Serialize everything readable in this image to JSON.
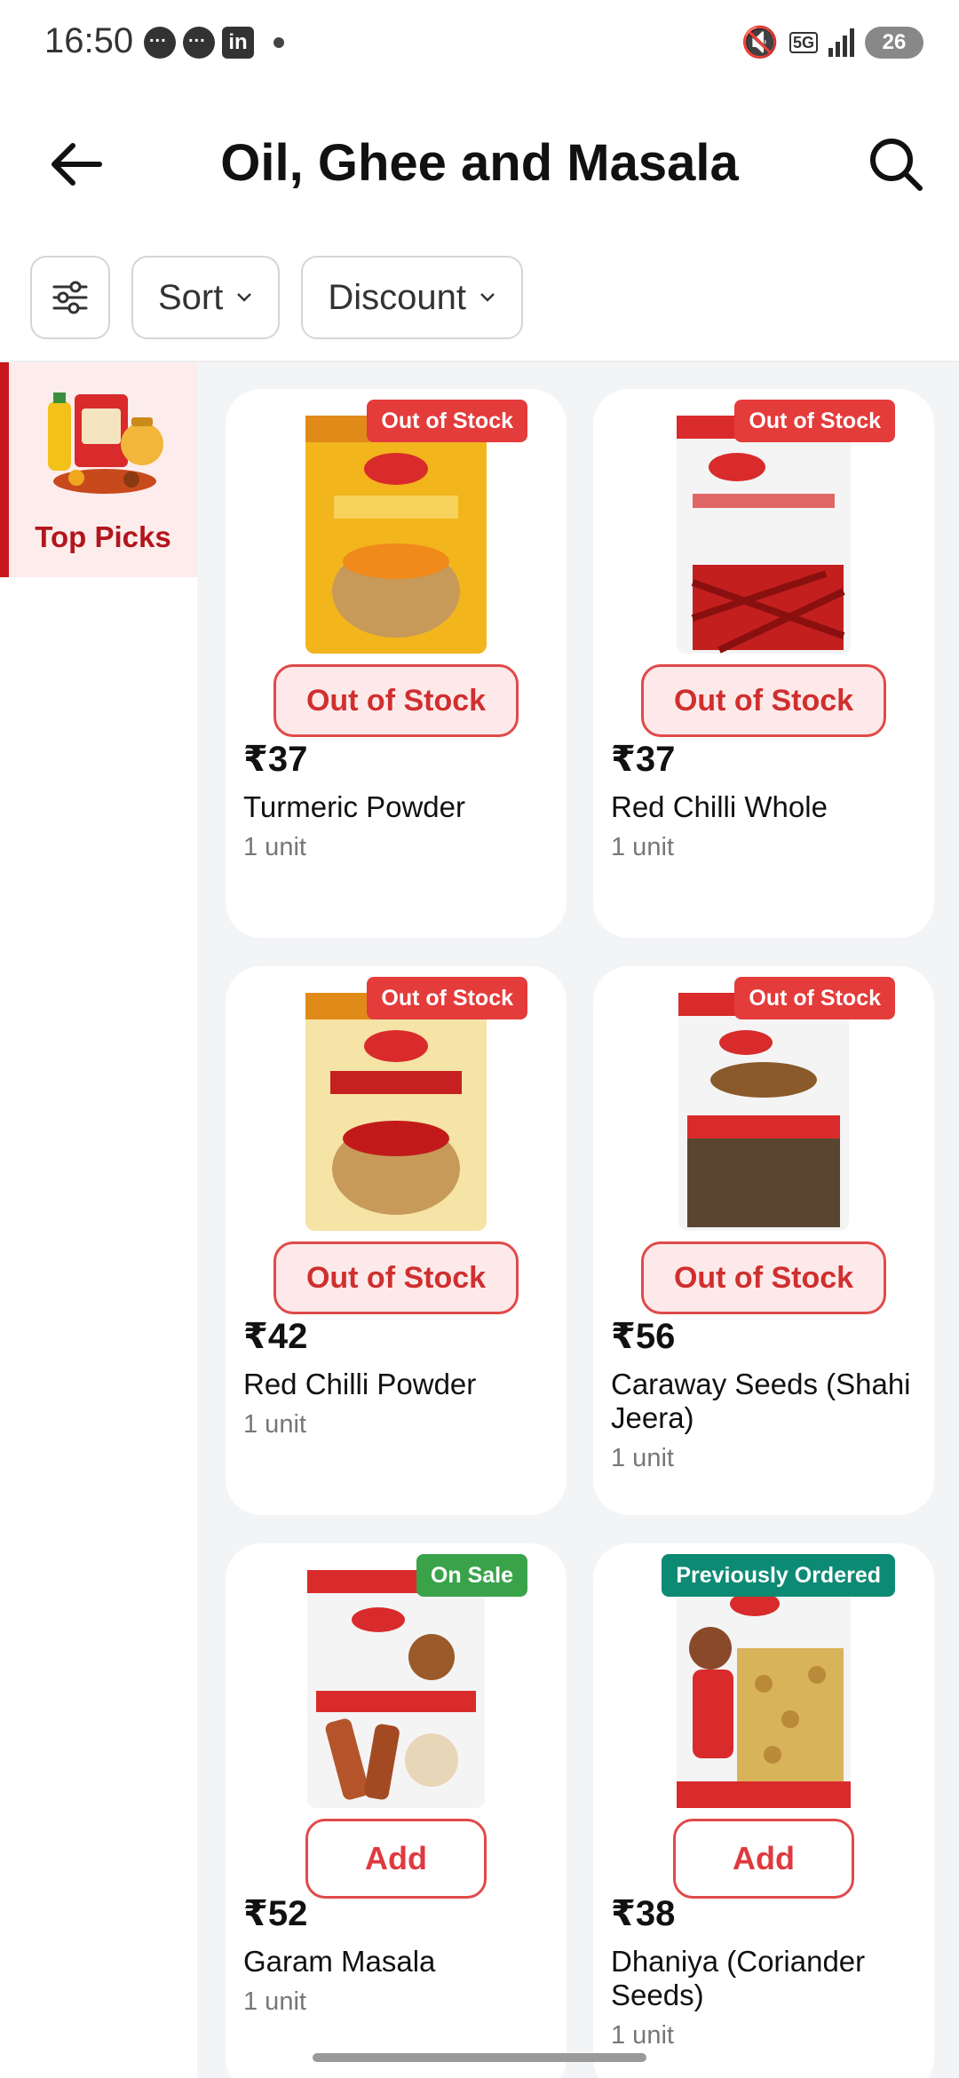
{
  "status_bar": {
    "time": "16:50",
    "network": "5G",
    "battery": "26"
  },
  "header": {
    "title": "Oil, Ghee and Masala"
  },
  "filters": {
    "sort_label": "Sort",
    "discount_label": "Discount"
  },
  "sidebar": {
    "items": [
      {
        "label": "Top Picks",
        "active": true
      }
    ]
  },
  "products": [
    {
      "badge": "Out of Stock",
      "badge_type": "oos",
      "action": "Out of Stock",
      "price": "₹37",
      "name": "Turmeric Powder",
      "unit": "1 unit",
      "image_colors": [
        "#f2b51c",
        "#e94e25"
      ]
    },
    {
      "badge": "Out of Stock",
      "badge_type": "oos",
      "action": "Out of Stock",
      "price": "₹37",
      "name": "Red Chilli Whole",
      "unit": "1 unit",
      "image_colors": [
        "#d92b2b",
        "#f5f5f5"
      ]
    },
    {
      "badge": "Out of Stock",
      "badge_type": "oos",
      "action": "Out of Stock",
      "price": "₹42",
      "name": "Red Chilli Powder",
      "unit": "1 unit",
      "image_colors": [
        "#f4dc8a",
        "#c62020"
      ]
    },
    {
      "badge": "Out of Stock",
      "badge_type": "oos",
      "action": "Out of Stock",
      "price": "₹56",
      "name": "Caraway Seeds (Shahi Jeera)",
      "unit": "1 unit",
      "image_colors": [
        "#4a3a2a",
        "#d92b2b"
      ]
    },
    {
      "badge": "On Sale",
      "badge_type": "sale",
      "action": "Add",
      "price": "₹52",
      "name": "Garam Masala",
      "unit": "1 unit",
      "image_colors": [
        "#b5542a",
        "#d92b2b"
      ]
    },
    {
      "badge": "Previously Ordered",
      "badge_type": "prev",
      "action": "Add",
      "price": "₹38",
      "name": "Dhaniya (Coriander Seeds)",
      "unit": "1 unit",
      "image_colors": [
        "#d9b35a",
        "#d92b2b"
      ]
    }
  ]
}
